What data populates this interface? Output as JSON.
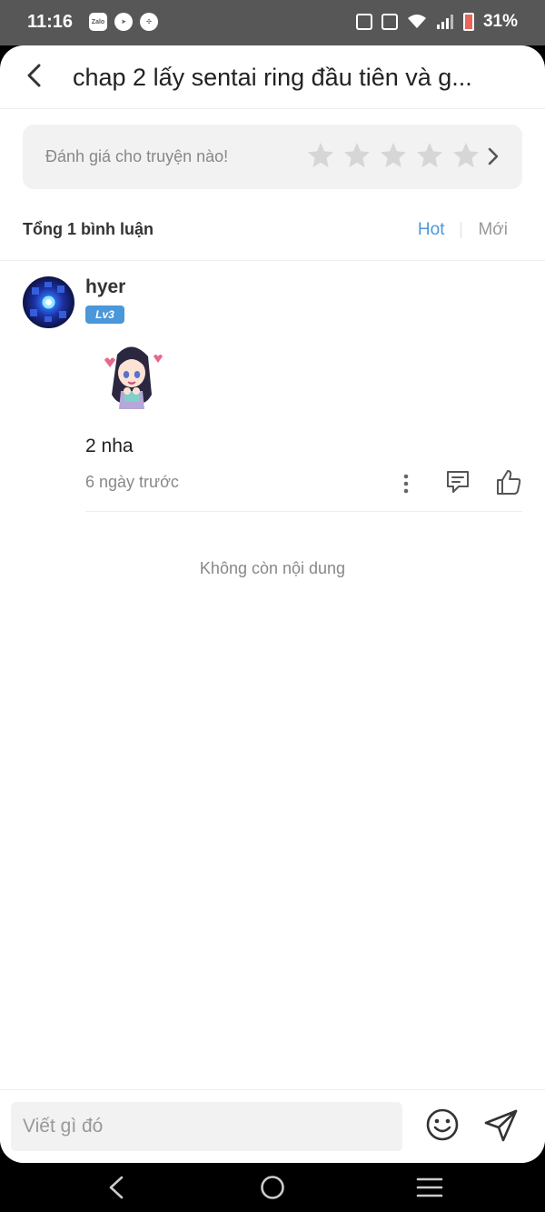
{
  "status": {
    "time": "11:16",
    "left_icons": [
      "zalo-icon",
      "messenger-icon",
      "pinwheel-icon"
    ],
    "battery": "31%",
    "zalo_label": "Zalo"
  },
  "header": {
    "title": "chap 2 lấy sentai ring đầu tiên và g..."
  },
  "rating": {
    "prompt": "Đánh giá cho truyện nào!",
    "stars": 5,
    "filled": 0
  },
  "comments_header": {
    "total": "Tổng 1 bình luận",
    "sort_hot": "Hot",
    "sort_new": "Mới"
  },
  "comments": [
    {
      "username": "hyer",
      "level": "Lv3",
      "text": "2 nha",
      "time": "6 ngày trước"
    }
  ],
  "end_text": "Không còn nội dung",
  "composer": {
    "placeholder": "Viết gì đó"
  },
  "colors": {
    "accent": "#4a97d9",
    "status_bar": "#575757",
    "muted_text": "#888888"
  }
}
